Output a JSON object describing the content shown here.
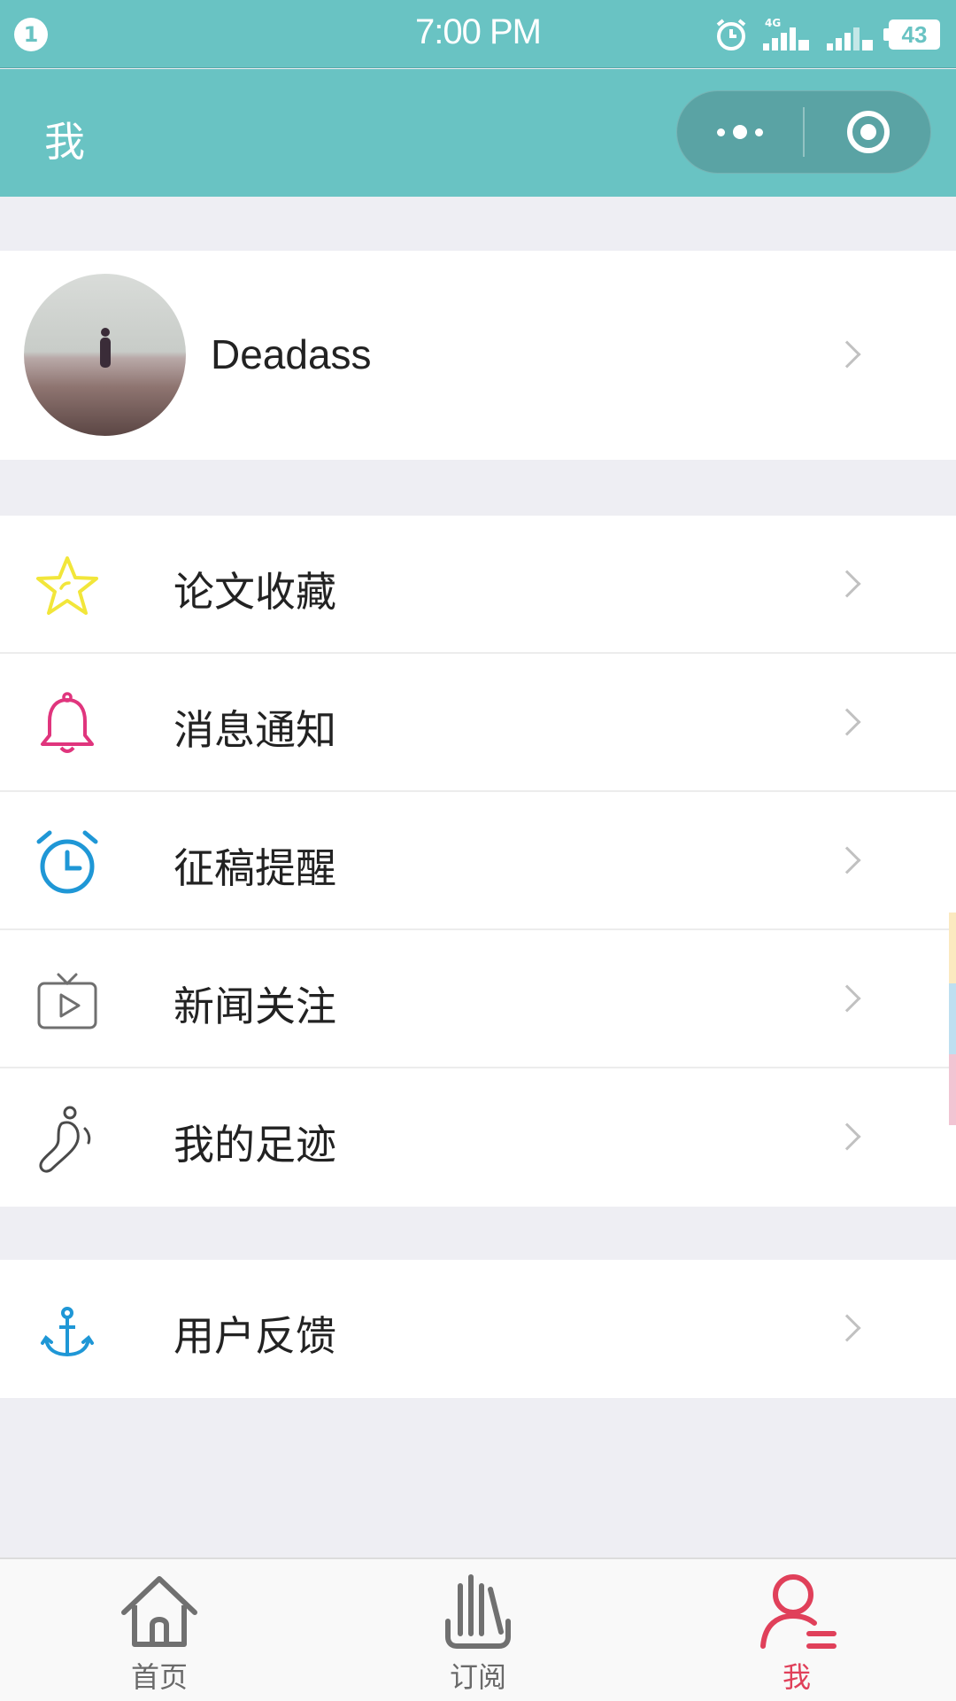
{
  "status_bar": {
    "notification_count": "1",
    "time": "7:00 PM",
    "network": "4G",
    "battery": "43"
  },
  "nav": {
    "title": "我"
  },
  "profile": {
    "username": "Deadass"
  },
  "menu": {
    "group1": [
      {
        "label": "论文收藏",
        "icon": "star-icon",
        "color": "#f2e63a"
      },
      {
        "label": "消息通知",
        "icon": "bell-icon",
        "color": "#e0357d"
      },
      {
        "label": "征稿提醒",
        "icon": "alarm-clock-icon",
        "color": "#1f97d6"
      },
      {
        "label": "新闻关注",
        "icon": "tv-play-icon",
        "color": "#6f6f6f"
      },
      {
        "label": "我的足迹",
        "icon": "footprint-icon",
        "color": "#4a4a4a"
      }
    ],
    "group2": [
      {
        "label": "用户反馈",
        "icon": "anchor-icon",
        "color": "#1f97d6"
      }
    ]
  },
  "tabbar": [
    {
      "label": "首页",
      "icon": "home-icon",
      "active": false
    },
    {
      "label": "订阅",
      "icon": "subscribe-icon",
      "active": false
    },
    {
      "label": "我",
      "icon": "profile-icon",
      "active": true
    }
  ],
  "colors": {
    "theme": "#69c3c3",
    "active_tab": "#e0405a",
    "background": "#eeeef3"
  }
}
